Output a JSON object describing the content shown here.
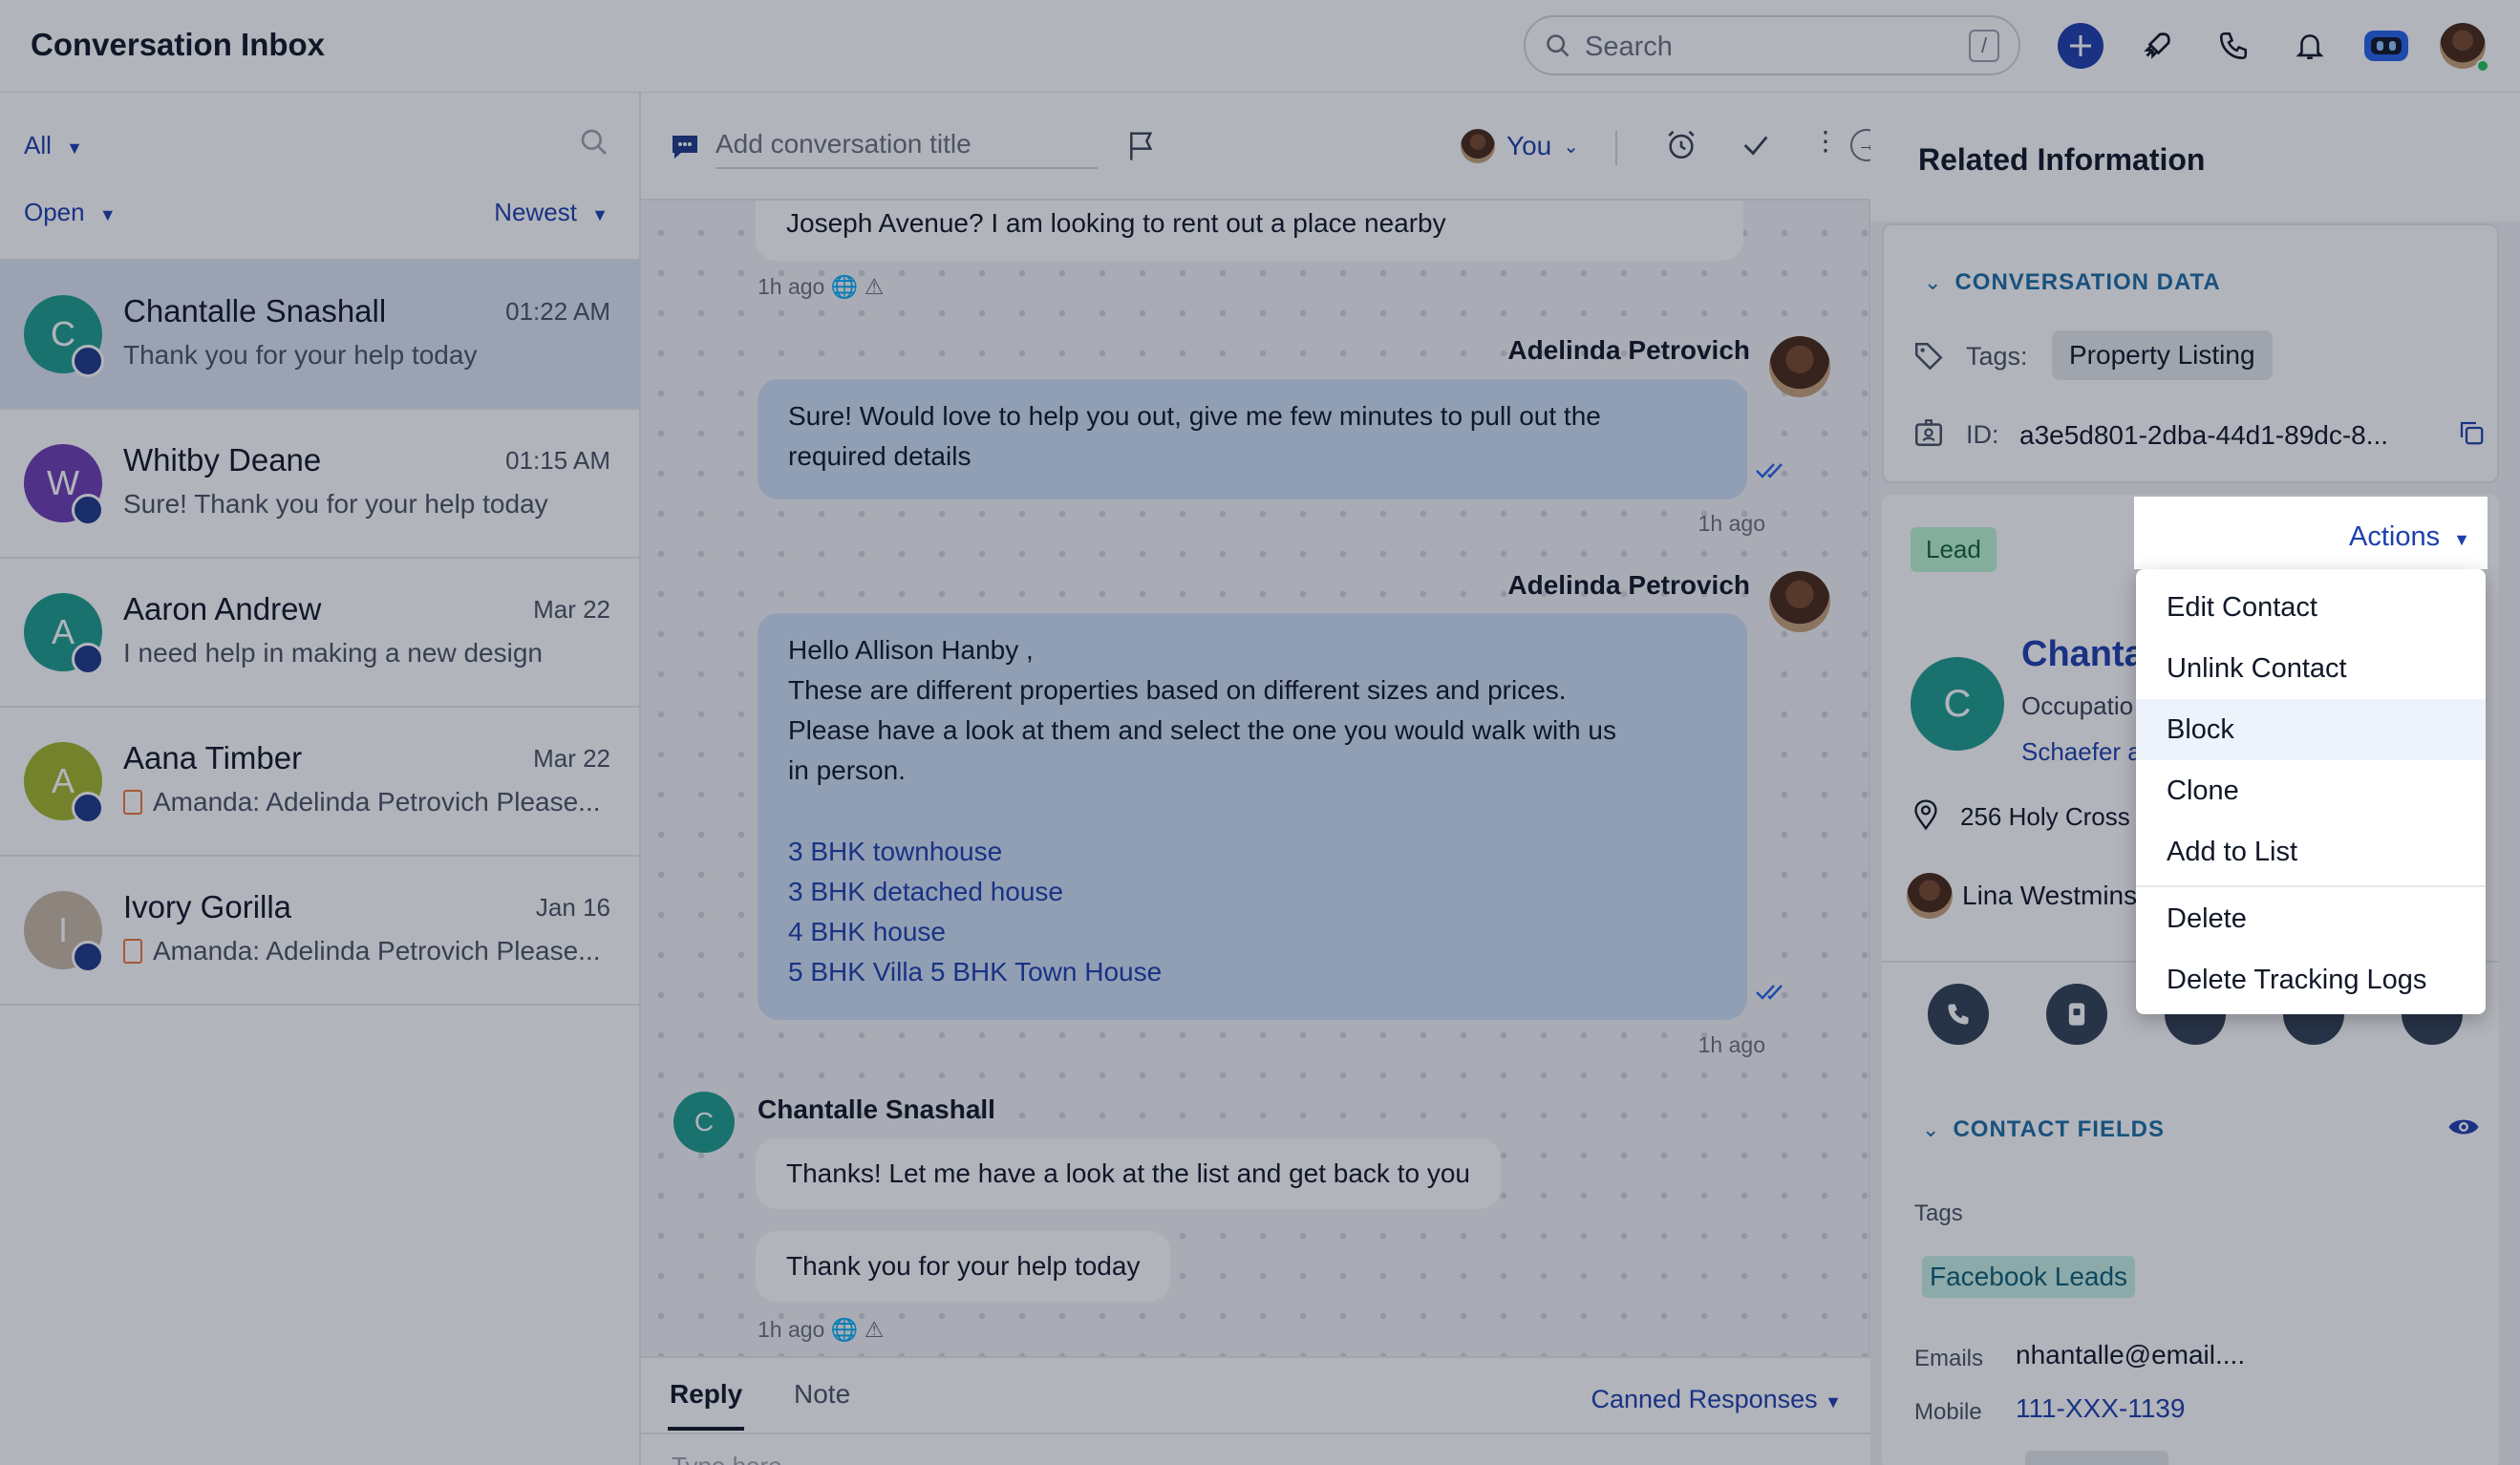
{
  "header": {
    "title": "Conversation Inbox",
    "search_placeholder": "Search",
    "search_shortcut": "/"
  },
  "list": {
    "filter_all": "All",
    "filter_status": "Open",
    "sort": "Newest",
    "conversations": [
      {
        "initial": "C",
        "name": "Chantalle Snashall",
        "time": "01:22 AM",
        "preview": "Thank you for your help today",
        "color": "#1f9e8f",
        "active": true
      },
      {
        "initial": "W",
        "name": "Whitby Deane",
        "time": "01:15 AM",
        "preview": "Sure! Thank you for your help today",
        "color": "#6d3fb4"
      },
      {
        "initial": "A",
        "name": "Aaron Andrew",
        "time": "Mar 22",
        "preview": "I need help in making a new design",
        "color": "#1f9e8f"
      },
      {
        "initial": "A",
        "name": "Aana Timber",
        "time": "Mar 22",
        "preview": "Amanda: Adelinda Petrovich Please...",
        "color": "#a3b52c"
      },
      {
        "initial": "I",
        "name": "Ivory Gorilla",
        "time": "Jan 16",
        "preview": "Amanda: Adelinda Petrovich Please...",
        "color": "#c9b9a6"
      }
    ]
  },
  "conversation": {
    "title_placeholder": "Add conversation title",
    "assignee": "You",
    "msg0_text": "Joseph Avenue? I am looking to rent out a place nearby",
    "msg0_time": "1h ago",
    "msg1_sender": "Adelinda Petrovich",
    "msg1_line1": "Sure! Would love to help you out, give me few minutes to pull out the",
    "msg1_line2": "required details",
    "msg1_time": "1h ago",
    "msg2_sender": "Adelinda Petrovich",
    "msg2_lines": [
      "Hello Allison Hanby ,",
      "These are different properties based on different sizes and prices.",
      "Please have a look at them and select the one you would walk with us",
      "in person."
    ],
    "msg2_links": [
      "3 BHK townhouse",
      "3 BHK detached house",
      "4 BHK house",
      "5 BHK Villa 5 BHK Town House"
    ],
    "msg2_time": "1h ago",
    "msg3_initial": "C",
    "msg3_sender": "Chantalle Snashall",
    "msg3_text": "Thanks! Let me have a look at the list and get back to you",
    "msg4_text": "Thank you for your help today",
    "msg4_time": "1h ago",
    "reply_tab": "Reply",
    "note_tab": "Note",
    "canned": "Canned Responses",
    "type_placeholder": "Type here"
  },
  "related": {
    "title": "Related Information",
    "conv_data_title": "CONVERSATION DATA",
    "tags_label": "Tags:",
    "tag_value": "Property Listing",
    "id_label": "ID:",
    "id_value": "a3e5d801-2dba-44d1-89dc-8...",
    "lead_badge": "Lead",
    "actions_label": "Actions",
    "contact_initial": "C",
    "contact_name_partial": "Chanta",
    "occupation_partial": "Occupatio",
    "company_partial": "Schaefer a",
    "address_partial": "256 Holy Cross",
    "owner_partial": "Lina Westmins",
    "contact_fields_title": "CONTACT FIELDS",
    "cf_tags_label": "Tags",
    "cf_tag_value": "Facebook Leads",
    "emails_label": "Emails",
    "emails_value": "nhantalle@email....",
    "mobile_label": "Mobile",
    "mobile_value": "111-XXX-1139"
  },
  "actions_menu": {
    "items": [
      "Edit Contact",
      "Unlink Contact",
      "Block",
      "Clone",
      "Add to List",
      "Delete",
      "Delete Tracking Logs"
    ]
  }
}
